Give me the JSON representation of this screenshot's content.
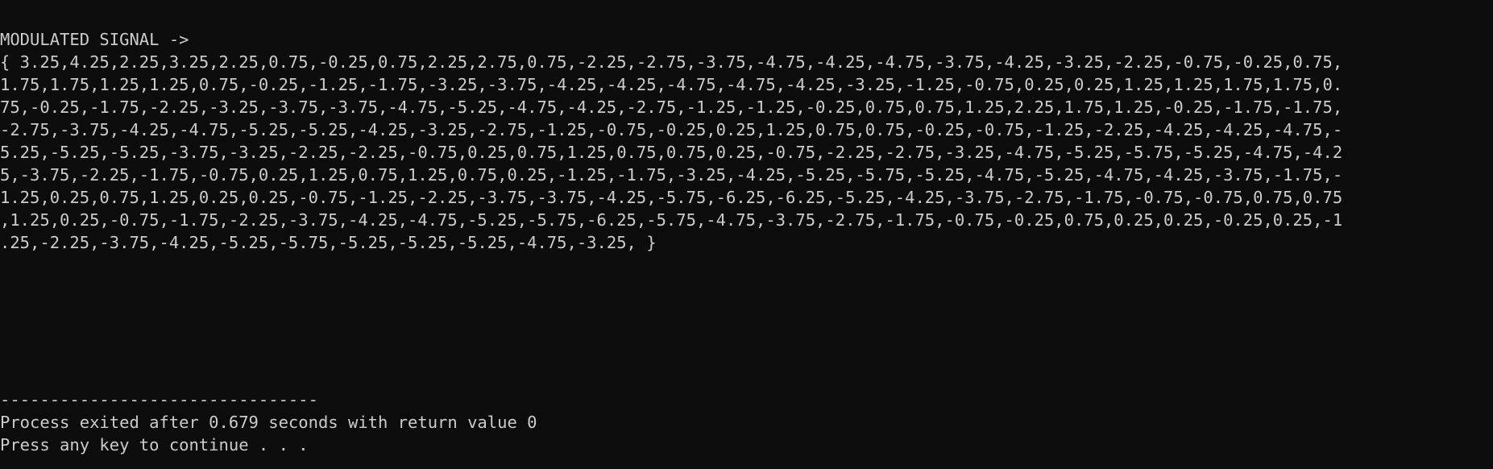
{
  "console": {
    "header": "MODULATED SIGNAL ->",
    "signal_lines": [
      "{ 3.25,4.25,2.25,3.25,2.25,0.75,-0.25,0.75,2.25,2.75,0.75,-2.25,-2.75,-3.75,-4.75,-4.25,-4.75,-3.75,-4.25,-3.25,-2.25,-0.75,-0.25,0.75,",
      "1.75,1.75,1.25,1.25,0.75,-0.25,-1.25,-1.75,-3.25,-3.75,-4.25,-4.25,-4.75,-4.75,-4.25,-3.25,-1.25,-0.75,0.25,0.25,1.25,1.25,1.75,1.75,0.",
      "75,-0.25,-1.75,-2.25,-3.25,-3.75,-3.75,-4.75,-5.25,-4.75,-4.25,-2.75,-1.25,-1.25,-0.25,0.75,0.75,1.25,2.25,1.75,1.25,-0.25,-1.75,-1.75,",
      "-2.75,-3.75,-4.25,-4.75,-5.25,-5.25,-4.25,-3.25,-2.75,-1.25,-0.75,-0.25,0.25,1.25,0.75,0.75,-0.25,-0.75,-1.25,-2.25,-4.25,-4.25,-4.75,-",
      "5.25,-5.25,-5.25,-3.75,-3.25,-2.25,-2.25,-0.75,0.25,0.75,1.25,0.75,0.75,0.25,-0.75,-2.25,-2.75,-3.25,-4.75,-5.25,-5.75,-5.25,-4.75,-4.2",
      "5,-3.75,-2.25,-1.75,-0.75,0.25,1.25,0.75,1.25,0.75,0.25,-1.25,-1.75,-3.25,-4.25,-5.25,-5.75,-5.25,-4.75,-5.25,-4.75,-4.25,-3.75,-1.75,-",
      "1.25,0.25,0.75,1.25,0.25,0.25,-0.75,-1.25,-2.25,-3.75,-3.75,-4.25,-5.75,-6.25,-6.25,-5.25,-4.25,-3.75,-2.75,-1.75,-0.75,-0.75,0.75,0.75",
      ",1.25,0.25,-0.75,-1.75,-2.25,-3.75,-4.25,-4.75,-5.25,-5.75,-6.25,-5.75,-4.75,-3.75,-2.75,-1.75,-0.75,-0.25,0.75,0.25,0.25,-0.25,0.25,-1",
      ".25,-2.25,-3.75,-4.25,-5.25,-5.75,-5.25,-5.25,-5.25,-4.75,-3.25, }"
    ],
    "separator": "--------------------------------",
    "exit_message": "Process exited after 0.679 seconds with return value 0",
    "continue_prompt": "Press any key to continue . . ."
  },
  "colors": {
    "background": "#0c0c0c",
    "text": "#cccccc"
  }
}
